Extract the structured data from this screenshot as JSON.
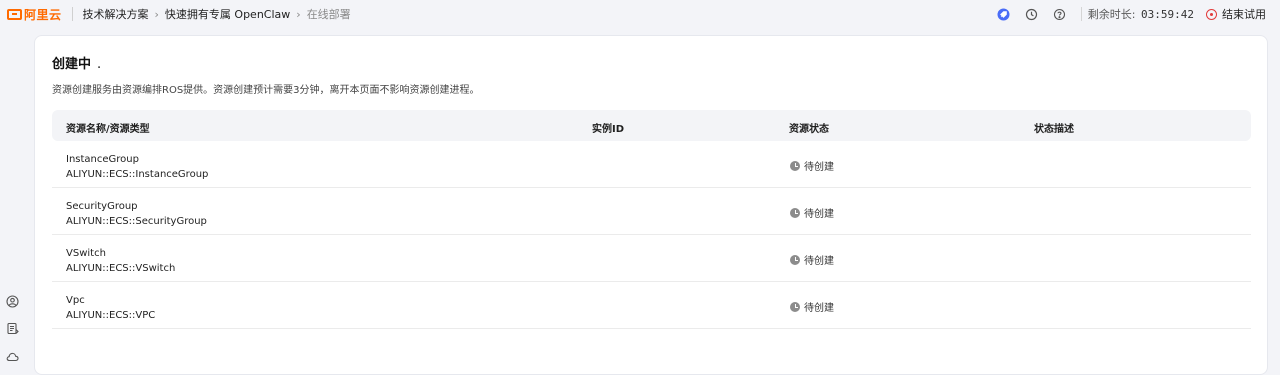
{
  "brand": {
    "logo_text": "阿里云",
    "color": "#ff6a00"
  },
  "breadcrumb": [
    "技术解决方案",
    "快速拥有专属 OpenClaw",
    "在线部署"
  ],
  "topbar": {
    "icons": [
      "rocket-icon",
      "history-icon",
      "help-icon"
    ],
    "remaining_label": "剩余时长:",
    "remaining_time": "03:59:42",
    "end_trial_label": "结束试用"
  },
  "rail": {
    "icons": [
      "user-icon",
      "document-icon",
      "cloud-icon"
    ]
  },
  "main": {
    "title": "创建中",
    "title_suffix": ".",
    "description": "资源创建服务由资源编排ROS提供。资源创建预计需要3分钟，离开本页面不影响资源创建进程。",
    "columns": [
      "资源名称/资源类型",
      "实例ID",
      "资源状态",
      "状态描述"
    ],
    "rows": [
      {
        "name": "InstanceGroup",
        "type": "ALIYUN::ECS::InstanceGroup",
        "instance_id": "",
        "status": "待创建",
        "status_desc": ""
      },
      {
        "name": "SecurityGroup",
        "type": "ALIYUN::ECS::SecurityGroup",
        "instance_id": "",
        "status": "待创建",
        "status_desc": ""
      },
      {
        "name": "VSwitch",
        "type": "ALIYUN::ECS::VSwitch",
        "instance_id": "",
        "status": "待创建",
        "status_desc": ""
      },
      {
        "name": "Vpc",
        "type": "ALIYUN::ECS::VPC",
        "instance_id": "",
        "status": "待创建",
        "status_desc": ""
      }
    ]
  }
}
